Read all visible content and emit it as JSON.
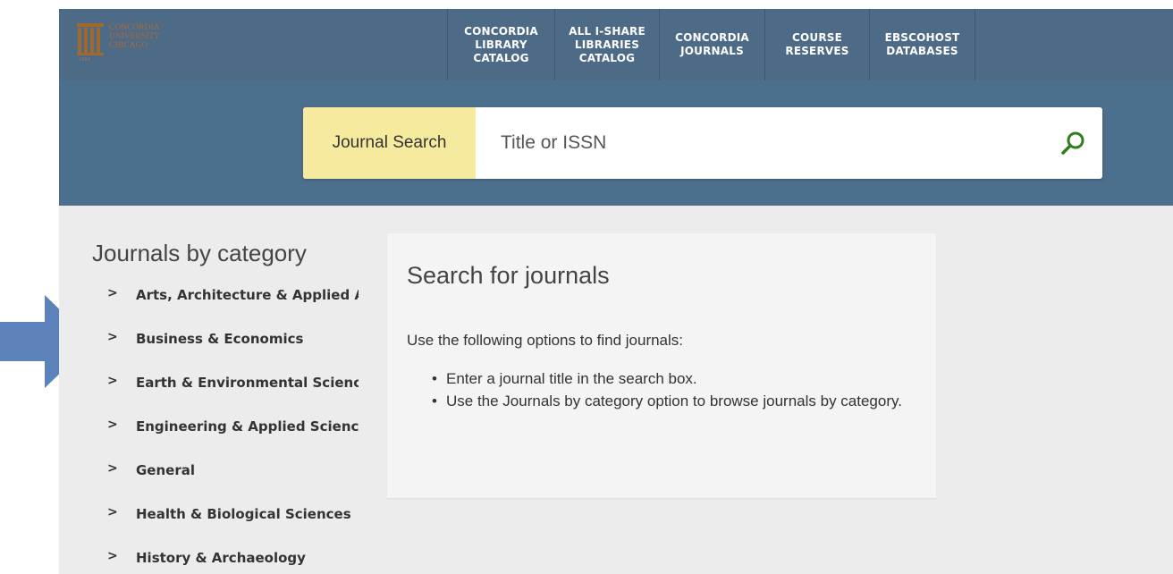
{
  "header": {
    "logo_lines": [
      "CONCORDIA",
      "UNIVERSITY",
      "CHICAGO"
    ],
    "logo_year": "1864",
    "nav": [
      {
        "label": "CONCORDIA\nLIBRARY\nCATALOG"
      },
      {
        "label": "ALL I-SHARE\nLIBRARIES\nCATALOG"
      },
      {
        "label": "CONCORDIA\nJOURNALS"
      },
      {
        "label": "COURSE\nRESERVES"
      },
      {
        "label": "EBSCOHOST\nDATABASES"
      }
    ]
  },
  "search": {
    "label": "Journal Search",
    "placeholder": "Title or ISSN",
    "icon": "search-icon"
  },
  "sidebar": {
    "title": "Journals by category",
    "categories": [
      {
        "label": "Arts, Architecture & Applied Ar"
      },
      {
        "label": "Business & Economics"
      },
      {
        "label": "Earth & Environmental Science"
      },
      {
        "label": "Engineering & Applied Science"
      },
      {
        "label": "General"
      },
      {
        "label": "Health & Biological Sciences"
      },
      {
        "label": "History & Archaeology"
      }
    ]
  },
  "main": {
    "heading": "Search for journals",
    "intro": "Use the following options to find journals:",
    "bullets": [
      "Enter a journal title in the search box.",
      "Use the Journals by category option to browse journals by category."
    ]
  },
  "colors": {
    "header_bg": "#4d6a87",
    "search_band": "#4d6f8e",
    "search_label_bg": "#f6ea9e",
    "search_icon": "#2e7d1f",
    "arrow": "#5b82ba",
    "logo": "#a06a2f"
  }
}
